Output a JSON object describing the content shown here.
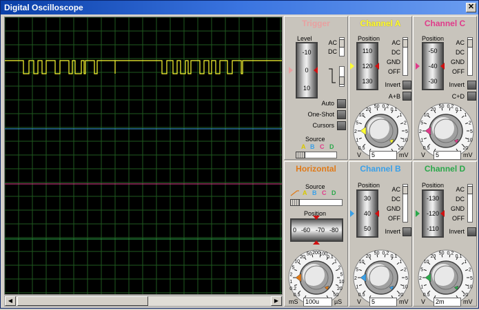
{
  "window": {
    "title": "Digital Oscilloscope",
    "close_glyph": "✕"
  },
  "colors": {
    "channel_a": "#ffff33",
    "channel_b": "#3aa0e8",
    "channel_c": "#e03a8a",
    "channel_d": "#2aa84a",
    "trigger": "#e8a0a0",
    "horizontal": "#e07a18",
    "grid": "#1f5a1f"
  },
  "trigger": {
    "title": "Trigger",
    "level_label": "Level",
    "wheel_ticks": [
      "-10",
      "0",
      "10"
    ],
    "coupling": [
      "AC",
      "DC"
    ],
    "mode_buttons": [
      "Auto",
      "One-Shot",
      "Cursors"
    ],
    "source_label": "Source",
    "sources": [
      "A",
      "B",
      "C",
      "D"
    ]
  },
  "channel_a": {
    "title": "Channel A",
    "position_label": "Position",
    "wheel_ticks": [
      "110",
      "120",
      "130"
    ],
    "coupling": [
      "AC",
      "DC",
      "GND",
      "OFF"
    ],
    "invert_label": "Invert",
    "combine_label": "A+B",
    "knob_scale": [
      "0.5",
      "1",
      "2",
      "5",
      "10",
      "20",
      "50",
      "0.2",
      "0.1",
      "1",
      "2",
      "5",
      "10",
      "20"
    ],
    "knob_value": "5",
    "unit_left": "V",
    "unit_right": "mV"
  },
  "channel_c": {
    "title": "Channel C",
    "position_label": "Position",
    "wheel_ticks": [
      "-50",
      "-40",
      "-30"
    ],
    "coupling": [
      "AC",
      "DC",
      "GND",
      "OFF"
    ],
    "invert_label": "Invert",
    "combine_label": "C+D",
    "knob_scale": [
      "0.5",
      "1",
      "2",
      "5",
      "10",
      "20",
      "50",
      "0.2",
      "0.1",
      "1",
      "2",
      "5",
      "10",
      "20"
    ],
    "knob_value": "5",
    "unit_left": "V",
    "unit_right": "mV"
  },
  "horizontal": {
    "title": "Horizontal",
    "source_label": "Source",
    "sources": [
      "A",
      "B",
      "C",
      "D"
    ],
    "position_label": "Position",
    "position_ticks": [
      "0",
      "-60",
      "-70",
      "-80"
    ],
    "knob_scale": [
      "0.5",
      "0.2",
      "1",
      "2",
      "5",
      "10",
      "20",
      "50",
      "200",
      "100",
      "0.1",
      "1",
      "2",
      "5",
      "10",
      "20",
      "50"
    ],
    "knob_value": "100u",
    "unit_left": "mS",
    "unit_right": "µS"
  },
  "channel_b": {
    "title": "Channel B",
    "position_label": "Position",
    "wheel_ticks": [
      "30",
      "40",
      "50"
    ],
    "coupling": [
      "AC",
      "DC",
      "GND",
      "OFF"
    ],
    "invert_label": "Invert",
    "knob_scale": [
      "0.5",
      "1",
      "2",
      "5",
      "10",
      "20",
      "50",
      "0.2",
      "0.1",
      "1",
      "2",
      "5",
      "10",
      "20"
    ],
    "knob_value": "5",
    "unit_left": "V",
    "unit_right": "mV"
  },
  "channel_d": {
    "title": "Channel D",
    "position_label": "Position",
    "wheel_ticks": [
      "-130",
      "-120",
      "-110"
    ],
    "coupling": [
      "AC",
      "DC",
      "GND",
      "OFF"
    ],
    "invert_label": "Invert",
    "knob_scale": [
      "0.5",
      "1",
      "2",
      "5",
      "10",
      "20",
      "50",
      "0.2",
      "0.1",
      "1",
      "2",
      "5",
      "10",
      "20"
    ],
    "knob_value": "2m",
    "unit_left": "V",
    "unit_right": "mV"
  },
  "scrollbar": {
    "left_glyph": "◀",
    "right_glyph": "▶"
  }
}
